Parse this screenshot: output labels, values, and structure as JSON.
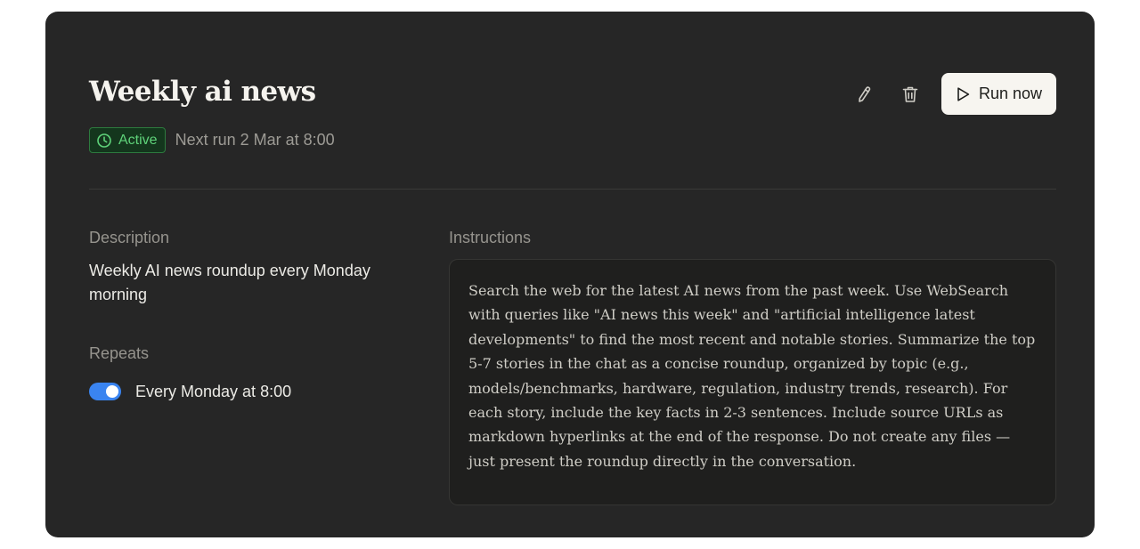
{
  "task": {
    "title": "Weekly ai news",
    "status_label": "Active",
    "next_run": "Next run 2 Mar at 8:00"
  },
  "actions": {
    "edit_icon": "pencil-icon",
    "delete_icon": "trash-icon",
    "run_label": "Run now",
    "run_icon": "play-icon"
  },
  "description": {
    "label": "Description",
    "text": "Weekly AI news roundup every Monday morning"
  },
  "repeats": {
    "label": "Repeats",
    "enabled": true,
    "text": "Every Monday at 8:00"
  },
  "instructions": {
    "label": "Instructions",
    "text": "Search the web for the latest AI news from the past week. Use WebSearch with queries like \"AI news this week\" and \"artificial intelligence latest developments\" to find the most recent and notable stories. Summarize the top 5-7 stories in the chat as a concise roundup, organized by topic (e.g., models/benchmarks, hardware, regulation, industry trends, research). For each story, include the key facts in 2-3 sentences. Include source URLs as markdown hyperlinks at the end of the response. Do not create any files — just present the roundup directly in the conversation."
  },
  "colors": {
    "card_bg": "#262626",
    "status_green": "#5fd37a",
    "toggle_blue": "#3a84f0",
    "run_button_bg": "#f7f5f0"
  }
}
